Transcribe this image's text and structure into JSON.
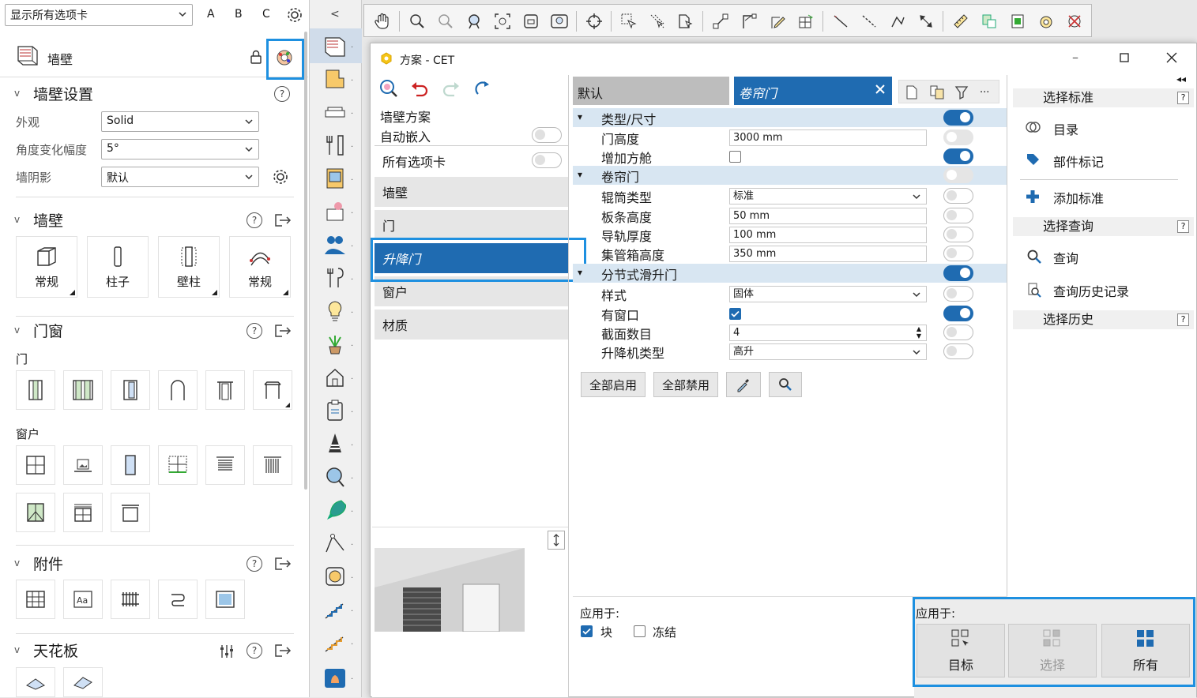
{
  "left": {
    "tab_select": "显示所有选项卡",
    "abc": [
      "A",
      "B",
      "C"
    ],
    "title": "墙壁",
    "wall_settings": {
      "header": "墙壁设置",
      "appearance_label": "外观",
      "appearance_value": "Solid",
      "angle_label": "角度变化幅度",
      "angle_value": "5°",
      "shadow_label": "墙阴影",
      "shadow_value": "默认"
    },
    "walls": {
      "header": "墙壁",
      "tiles": [
        "常规",
        "柱子",
        "壁柱",
        "常规"
      ]
    },
    "doors_windows": {
      "header": "门窗",
      "door_label": "门",
      "window_label": "窗户"
    },
    "accessories": {
      "header": "附件"
    },
    "ceiling": {
      "header": "天花板"
    }
  },
  "dialog": {
    "title": "方案 - CET",
    "left_col": {
      "scheme_label": "墙壁方案",
      "auto_embed_label": "自动嵌入",
      "all_tabs_label": "所有选项卡",
      "categories": [
        "墙壁",
        "门",
        "升降门",
        "窗户",
        "材质"
      ],
      "selected_index": 2
    },
    "tabs": {
      "default_tab": "默认",
      "active_tab": "卷帘门"
    },
    "props": [
      {
        "type": "group",
        "label": "类型/尺寸",
        "toggle": "on"
      },
      {
        "type": "text",
        "label": "门高度",
        "value": "3000 mm",
        "toggle": "dim"
      },
      {
        "type": "check",
        "label": "增加方舱",
        "checked": false,
        "toggle": "on"
      },
      {
        "type": "group",
        "label": "卷帘门",
        "toggle": "dim"
      },
      {
        "type": "select",
        "label": "辊筒类型",
        "value": "标准",
        "toggle": "off"
      },
      {
        "type": "text",
        "label": "板条高度",
        "value": "50 mm",
        "toggle": "off"
      },
      {
        "type": "text",
        "label": "导轨厚度",
        "value": "100 mm",
        "toggle": "off"
      },
      {
        "type": "text",
        "label": "集管箱高度",
        "value": "350 mm",
        "toggle": "off"
      },
      {
        "type": "group",
        "label": "分节式滑升门",
        "toggle": "on"
      },
      {
        "type": "select",
        "label": "样式",
        "value": "固体",
        "toggle": "off"
      },
      {
        "type": "check",
        "label": "有窗口",
        "checked": true,
        "toggle": "on"
      },
      {
        "type": "spin",
        "label": "截面数目",
        "value": "4",
        "toggle": "off"
      },
      {
        "type": "select",
        "label": "升降机类型",
        "value": "高升",
        "toggle": "off"
      }
    ],
    "buttons": {
      "enable_all": "全部启用",
      "disable_all": "全部禁用"
    },
    "apply_to": {
      "label": "应用于:",
      "block_label": "块",
      "block_checked": true,
      "freeze_label": "冻结",
      "freeze_checked": false
    },
    "right": {
      "select_standard": "选择标准",
      "catalog": "目录",
      "part_tag": "部件标记",
      "add_standard": "添加标准",
      "select_query": "选择查询",
      "query": "查询",
      "query_history": "查询历史记录",
      "select_history": "选择历史",
      "qmark": "?"
    },
    "apply_panel": {
      "label": "应用于:",
      "target": "目标",
      "select": "选择",
      "all": "所有"
    }
  },
  "colors": {
    "accent": "#1f6bb1",
    "highlight": "#1e90e0",
    "group_bg": "#d8e6f2"
  }
}
